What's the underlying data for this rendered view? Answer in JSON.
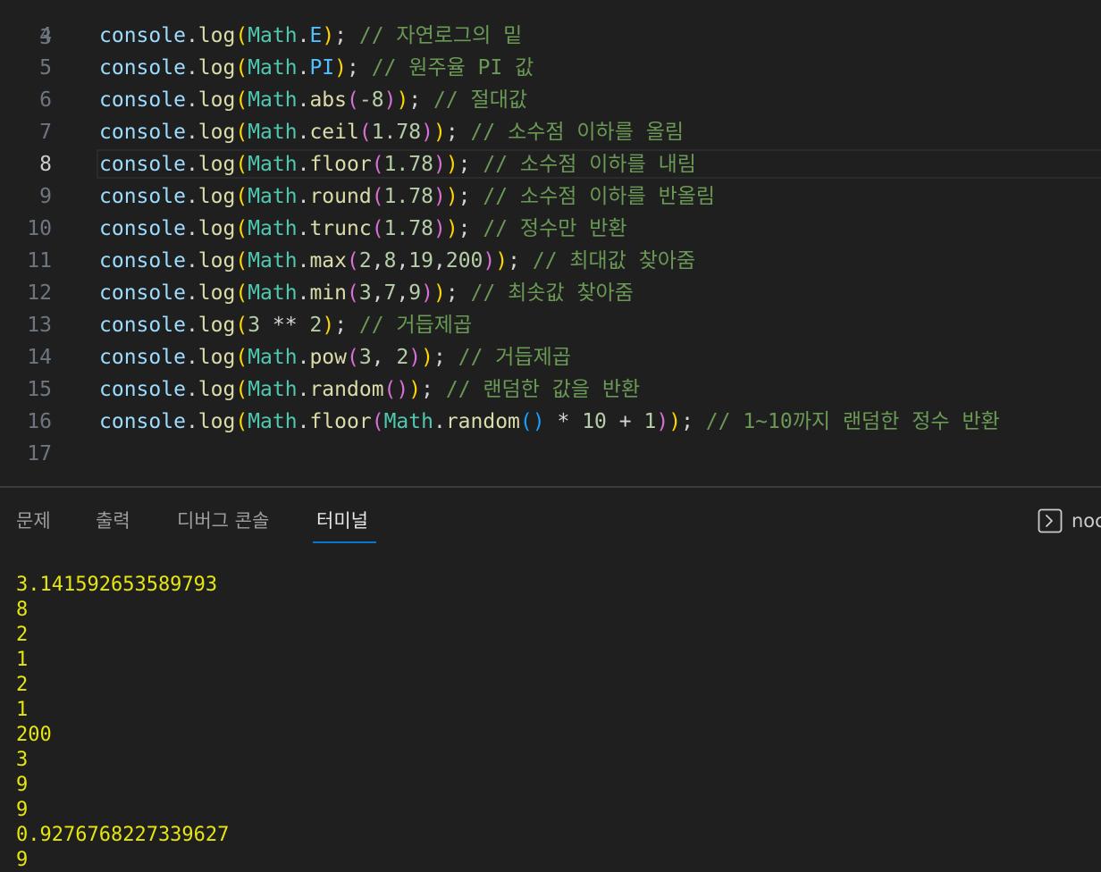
{
  "editor": {
    "top_line_number": "3",
    "current_line": "8",
    "lines": [
      {
        "number": "4",
        "code": "console.log(Math.E);",
        "comment": "// 자연로그의 밑"
      },
      {
        "number": "5",
        "code": "console.log(Math.PI);",
        "comment": "// 원주율 PI 값"
      },
      {
        "number": "6",
        "code": "console.log(Math.abs(-8));",
        "comment": "// 절대값"
      },
      {
        "number": "7",
        "code": "console.log(Math.ceil(1.78));",
        "comment": "// 소수점 이하를 올림"
      },
      {
        "number": "8",
        "code": "console.log(Math.floor(1.78));",
        "comment": "// 소수점 이하를 내림"
      },
      {
        "number": "9",
        "code": "console.log(Math.round(1.78));",
        "comment": "// 소수점 이하를 반올림"
      },
      {
        "number": "10",
        "code": "console.log(Math.trunc(1.78));",
        "comment": "// 정수만 반환"
      },
      {
        "number": "11",
        "code": "console.log(Math.max(2,8,19,200));",
        "comment": "// 최대값 찾아줌"
      },
      {
        "number": "12",
        "code": "console.log(Math.min(3,7,9));",
        "comment": "// 최솟값 찾아줌"
      },
      {
        "number": "13",
        "code": "console.log(3 ** 2);",
        "comment": "// 거듭제곱"
      },
      {
        "number": "14",
        "code": "console.log(Math.pow(3, 2));",
        "comment": "// 거듭제곱"
      },
      {
        "number": "15",
        "code": "console.log(Math.random());",
        "comment": "// 랜덤한 값을 반환"
      },
      {
        "number": "16",
        "code": "console.log(Math.floor(Math.random() * 10 + 1));",
        "comment": "// 1~10까지 랜덤한 정수 반환"
      },
      {
        "number": "17",
        "code": "",
        "comment": ""
      }
    ]
  },
  "panel": {
    "tabs": [
      {
        "label": "문제"
      },
      {
        "label": "출력"
      },
      {
        "label": "디버그 콘솔"
      },
      {
        "label": "터미널"
      }
    ],
    "active_tab": "터미널",
    "terminal_name": "noc",
    "terminal_icon": "terminal-icon"
  },
  "terminal": {
    "output": [
      "3.141592653589793",
      "8",
      "2",
      "1",
      "2",
      "1",
      "200",
      "3",
      "9",
      "9",
      "0.9276768227339627",
      "9"
    ]
  },
  "colors": {
    "background": "#1f1f1f",
    "variable": "#9cdcfe",
    "function": "#dcdcaa",
    "class": "#4ec9b0",
    "constant": "#4fc1ff",
    "number": "#b5cea8",
    "comment": "#6a9955",
    "bracket_1": "#ffd700",
    "bracket_2": "#da70d6",
    "bracket_3": "#179fff",
    "terminal_text": "#e5e510",
    "active_tab_indicator": "#0078d4"
  }
}
